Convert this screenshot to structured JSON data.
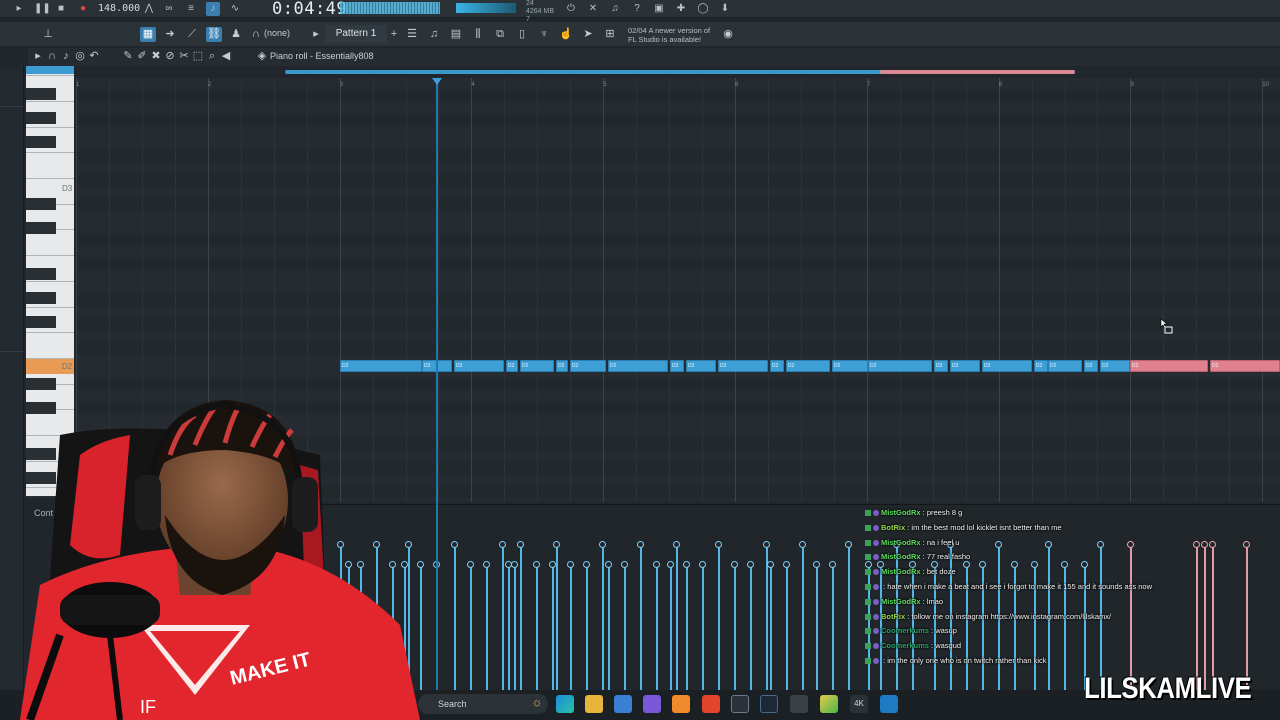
{
  "transport": {
    "tempo": "148.000",
    "time": "0:04:49",
    "cpu_line1": "24",
    "cpu_line2": "4264 MB",
    "cpu_line3": "7"
  },
  "toolbar": {
    "snap": "(none)",
    "pattern": "Pattern 1",
    "notice_line1": "02/04  A newer version of",
    "notice_line2": "FL Studio is available!"
  },
  "piano_roll": {
    "title": "Piano roll - Essentially808",
    "key_labels": [
      "D3",
      "D2"
    ],
    "bar_numbers": [
      "1",
      "2",
      "3",
      "4",
      "5",
      "6",
      "7",
      "8",
      "9",
      "10"
    ],
    "note_label": "D2"
  },
  "control": {
    "label": "Cont"
  },
  "chat": [
    {
      "user": "MistGodRx",
      "color": "#5fe05f",
      "text": " : preesh 8 g"
    },
    {
      "user": "BotRix",
      "color": "#9ad94f",
      "text": " : im the best mod lol kicklet isnt better than me"
    },
    {
      "user": "MistGodRx",
      "color": "#5fe05f",
      "text": " : na i feel u"
    },
    {
      "user": "MistGodRx",
      "color": "#5fe05f",
      "text": " : 77 real fasho"
    },
    {
      "user": "MistGodRx",
      "color": "#5fe05f",
      "text": " : bet doze"
    },
    {
      "user": "",
      "color": "#e04a4a",
      "text": " : hate when i make a beat and i see i forgot to make it 155 and it sounds ass now"
    },
    {
      "user": "MistGodRx",
      "color": "#5fe05f",
      "text": " : lmao"
    },
    {
      "user": "BotRix",
      "color": "#9ad94f",
      "text": " : follow me on instagram https://www.instagram.com/lilskamx/"
    },
    {
      "user": "Coomerkums",
      "color": "#2fa36b",
      "text": " : wasup"
    },
    {
      "user": "Coomerkums",
      "color": "#2fa36b",
      "text": " : wasgud"
    },
    {
      "user": "",
      "color": "#c4367a",
      "text": " : im the only one who is on twitch rather than kick"
    }
  ],
  "taskbar": {
    "search": "Search"
  },
  "overlay": {
    "watermark": "LILSKAMLIVE",
    "shirt_text": "MAKE IT",
    "shirt_text_2": "IF"
  },
  "colors": {
    "note_blue": "#3e9fd6",
    "note_pink": "#e0808e",
    "accent": "#3a7fb0",
    "key_highlight": "#e99a55"
  }
}
